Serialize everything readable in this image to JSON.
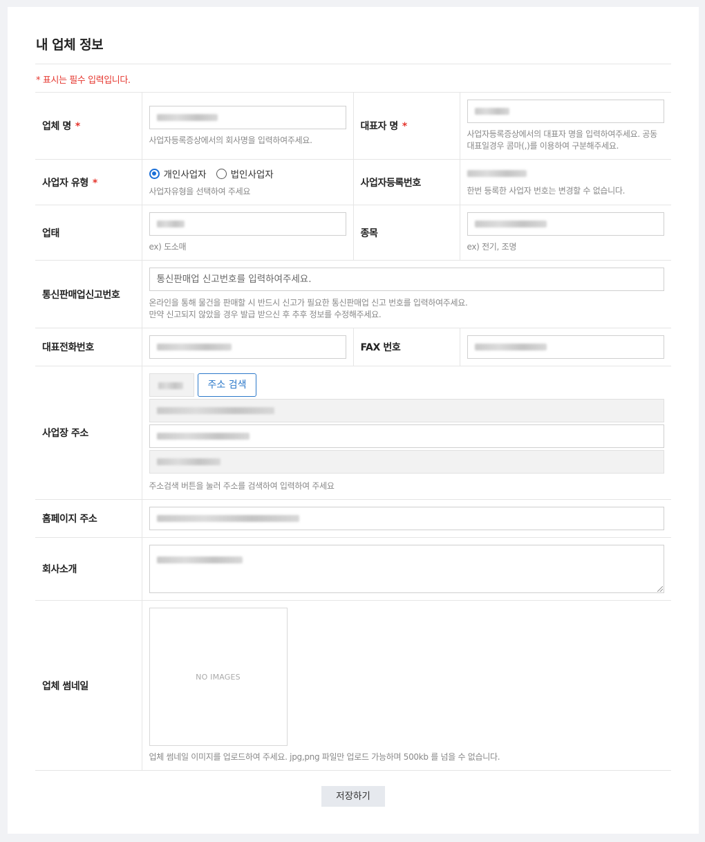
{
  "page": {
    "title": "내 업체 정보",
    "required_note": "* 표시는 필수 입력입니다."
  },
  "fields": {
    "company_name": {
      "label": "업체 명",
      "required": "*",
      "help": "사업자등록증상에서의 회사명을 입력하여주세요."
    },
    "ceo_name": {
      "label": "대표자 명",
      "required": "*",
      "help_line1": "사업자등록증상에서의 대표자 명을 입력하여주세요. 공동",
      "help_line2": "대표일경우 콤마(,)를 이용하여 구분해주세요."
    },
    "business_type": {
      "label": "사업자 유형",
      "required": "*",
      "options": [
        "개인사업자",
        "법인사업자"
      ],
      "selected": "개인사업자",
      "help": "사업자유형을 선택하여 주세요"
    },
    "business_number": {
      "label": "사업자등록번호",
      "help": "한번 등록한 사업자 번호는 변경할 수 없습니다."
    },
    "business_category": {
      "label": "업태",
      "help": "ex) 도소매"
    },
    "business_item": {
      "label": "종목",
      "help": "ex) 전기, 조명"
    },
    "ecommerce_number": {
      "label": "통신판매업신고번호",
      "placeholder": "통신판매업 신고번호를 입력하여주세요.",
      "help_line1": "온라인을 통해 물건을 판매할 시 반드시 신고가 필요한 통신판매업 신고 번호를 입력하여주세요.",
      "help_line2": "만약 신고되지 않았을 경우 발급 받으신 후 추후 정보를 수정해주세요."
    },
    "phone": {
      "label": "대표전화번호"
    },
    "fax": {
      "label": "FAX 번호"
    },
    "address": {
      "label": "사업장 주소",
      "search_button": "주소 검색",
      "help": "주소검색 버튼을 눌러 주소를 검색하여 입력하여 주세요"
    },
    "homepage": {
      "label": "홈페이지 주소"
    },
    "intro": {
      "label": "회사소개"
    },
    "thumbnail": {
      "label": "업체 썸네일",
      "empty_text": "NO IMAGES",
      "help": "업체 썸네일 이미지를 업로드하여 주세요. jpg,png 파일만 업로드 가능하며 500kb 를 넘을 수 없습니다."
    }
  },
  "actions": {
    "save_label": "저장하기"
  }
}
